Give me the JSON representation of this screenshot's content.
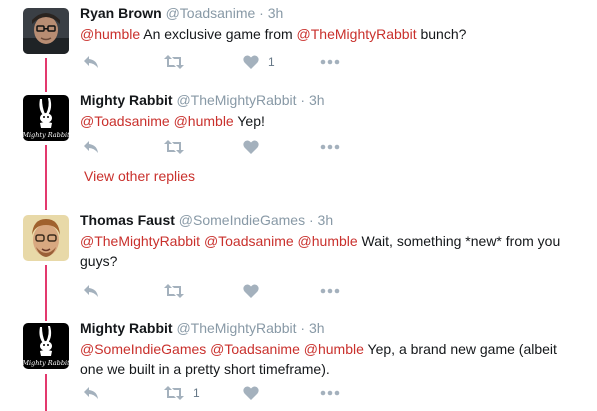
{
  "colors": {
    "accent": "#c9302c",
    "thread_line": "#e0245e",
    "muted": "#8899a6"
  },
  "tweets": [
    {
      "name": "Ryan Brown",
      "handle": "@Toadsanime",
      "dot": "·",
      "time": "3h",
      "segments": [
        {
          "text": "@humble",
          "mention": true
        },
        {
          "text": " An exclusive game from ",
          "mention": false
        },
        {
          "text": "@TheMightyRabbit",
          "mention": true
        },
        {
          "text": " bunch?",
          "mention": false
        }
      ],
      "like_count": "1",
      "retweet_count": ""
    },
    {
      "name": "Mighty Rabbit",
      "handle": "@TheMightyRabbit",
      "dot": "·",
      "time": "3h",
      "segments": [
        {
          "text": "@Toadsanime",
          "mention": true
        },
        {
          "text": " ",
          "mention": false
        },
        {
          "text": "@humble",
          "mention": true
        },
        {
          "text": " Yep!",
          "mention": false
        }
      ],
      "like_count": "",
      "retweet_count": ""
    },
    {
      "name": "Thomas Faust",
      "handle": "@SomeIndieGames",
      "dot": "·",
      "time": "3h",
      "segments": [
        {
          "text": "@TheMightyRabbit",
          "mention": true
        },
        {
          "text": " ",
          "mention": false
        },
        {
          "text": "@Toadsanime",
          "mention": true
        },
        {
          "text": " ",
          "mention": false
        },
        {
          "text": "@humble",
          "mention": true
        },
        {
          "text": " Wait, something *new* from you guys?",
          "mention": false
        }
      ],
      "like_count": "",
      "retweet_count": ""
    },
    {
      "name": "Mighty Rabbit",
      "handle": "@TheMightyRabbit",
      "dot": "·",
      "time": "3h",
      "segments": [
        {
          "text": "@SomeIndieGames",
          "mention": true
        },
        {
          "text": " ",
          "mention": false
        },
        {
          "text": "@Toadsanime",
          "mention": true
        },
        {
          "text": " ",
          "mention": false
        },
        {
          "text": "@humble",
          "mention": true
        },
        {
          "text": " Yep, a brand new game (albeit one we built in a pretty short timeframe).",
          "mention": false
        }
      ],
      "like_count": "",
      "retweet_count": "1"
    }
  ],
  "view_other_replies": "View other replies",
  "icons": {
    "reply": "reply-icon",
    "retweet": "retweet-icon",
    "like": "heart-icon",
    "more": "more-icon"
  }
}
